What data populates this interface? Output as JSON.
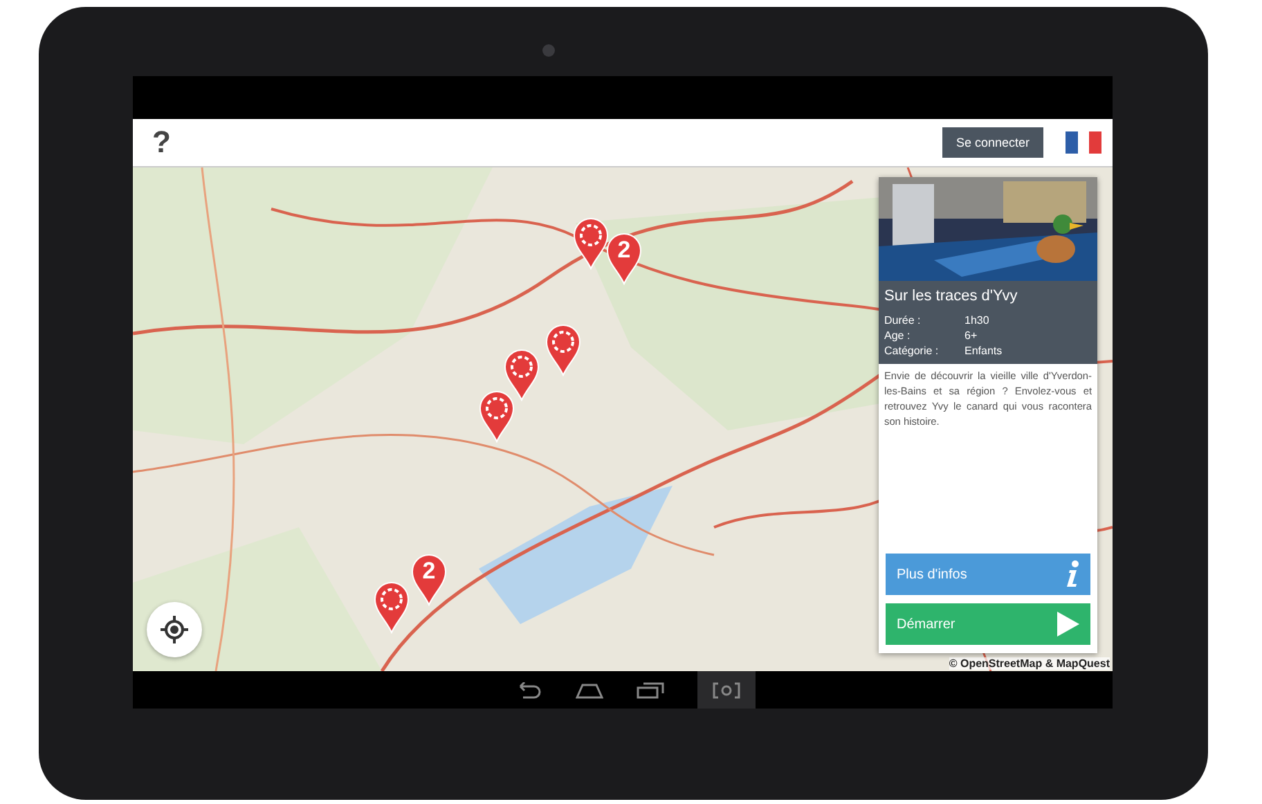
{
  "header": {
    "help": "?",
    "login_button": "Se connecter"
  },
  "map": {
    "kind": "picture",
    "attribution": "© OpenStreetMap & MapQuest",
    "pins": [
      {
        "kind": "single"
      },
      {
        "kind": "cluster",
        "count": "2"
      },
      {
        "kind": "single"
      },
      {
        "kind": "single"
      },
      {
        "kind": "single"
      },
      {
        "kind": "cluster",
        "count": "2"
      },
      {
        "kind": "single"
      }
    ]
  },
  "card": {
    "title": "Sur les traces d'Yvy",
    "details": [
      {
        "label": "Durée :",
        "value": "1h30"
      },
      {
        "label": "Age :",
        "value": "6+"
      },
      {
        "label": "Catégorie :",
        "value": "Enfants"
      }
    ],
    "description": "Envie de découvrir la vieille ville d'Yverdon-les-Bains et sa région ? Envolez-vous et retrouvez Yvy le canard qui vous racontera son histoire.",
    "buttons": [
      {
        "kind": "info",
        "label": "Plus d'infos"
      },
      {
        "kind": "start",
        "label": "Démarrer"
      }
    ]
  }
}
